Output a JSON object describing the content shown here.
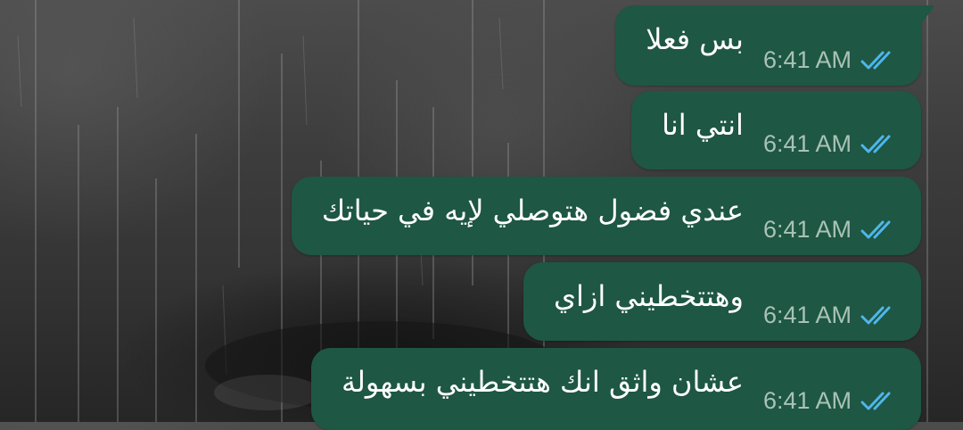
{
  "messages": [
    {
      "text": "بس فعلا",
      "time": "6:41 AM",
      "status": "read"
    },
    {
      "text": "انتي انا",
      "time": "6:41 AM",
      "status": "read"
    },
    {
      "text": "عندي فضول هتوصلي لإيه في حياتك",
      "time": "6:41 AM",
      "status": "read"
    },
    {
      "text": "وهتتخطيني ازاي",
      "time": "6:41 AM",
      "status": "read"
    },
    {
      "text": "عشان واثق انك هتتخطيني بسهولة",
      "time": "6:41 AM",
      "status": "read"
    }
  ],
  "colors": {
    "bubble_outgoing": "#1e5743",
    "read_ticks": "#4fb6ec",
    "time_text": "#a9c2b7",
    "message_text": "#ffffff"
  },
  "icons": {
    "status_read": "double-check-icon"
  }
}
